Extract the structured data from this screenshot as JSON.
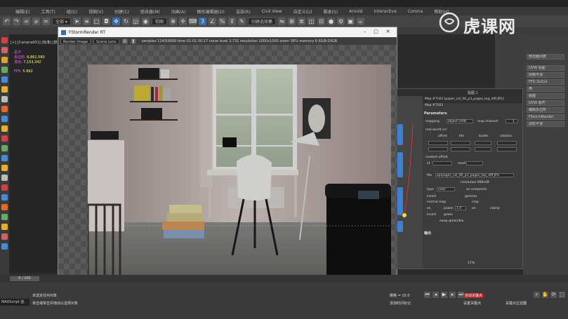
{
  "menu": [
    "编辑(E)",
    "工具(T)",
    "组(G)",
    "视图(V)",
    "创建(C)",
    "修改器(M)",
    "动画(A)",
    "图形编辑器(D)",
    "渲染(R)",
    "Civil View",
    "自定义(U)",
    "脚本(S)",
    "Arnold",
    "Interactive",
    "Corona",
    "帮助(H)"
  ],
  "toolbar": {
    "view_select": "视图",
    "selection_set": "创建选择集"
  },
  "viewport": {
    "label": "[+] [Camera001] [标准] [默认明暗处理]",
    "stats": {
      "header": "总计",
      "polys_label": "多边形:",
      "polys_value": "6,861,580",
      "verts_label": "顶点:",
      "verts_value": "7,153,342",
      "fps_label": "FPS:",
      "fps_value": "5.992"
    }
  },
  "framebuffer": {
    "title": "FStormRender RT",
    "layer_select": "Render Image",
    "lens_select": "Scene-Lens",
    "info": "samples 114/50000   time 01:01:30:17   noise level 3.731   resolution 1000x1000   zoom 38%   memory 6.60/8.00GB"
  },
  "material_editor": {
    "window_title": "贴图 1",
    "map_title": "Map #7163 [paper_col_06_p3_pages_top_diff.JPG]",
    "map_type": "Map #7163",
    "section_params": "Parameters",
    "mapping_label": "mapping",
    "mapping_value": "object UVW",
    "map_channel_label": "map channel",
    "map_channel_value": "1",
    "real_world_label": "real-world scl",
    "offset_label": "offset",
    "tiling_label": "tile",
    "mirror_label": "borde",
    "rotation_label": "rotation",
    "random_offset_label": "random offset",
    "id_label": "id",
    "seed_label": "seed",
    "file_label": "file",
    "file_value": "ap\\pages_col_06_p3_pages_top_diff.JPG",
    "resolution_label": "resolution 900x48",
    "type_label": "type",
    "type_value": "color",
    "as_compressed_label": "as compressi",
    "invert_label": "invert",
    "gamma_label": "gamma",
    "normal_map_label": "normal map",
    "crop_label": "crop",
    "on_label": "on",
    "power_label": "power",
    "power_value": "1.0",
    "clamp_label": "clamp",
    "green_label": "green",
    "swap_label": "swap green/blu",
    "section_output": "输出",
    "zoom_value": "17%"
  },
  "right_panel": {
    "buttons": [
      "修改器列表",
      "UVW 贴图",
      "网格平滑",
      "FFD 2x2x2",
      "壳",
      "曲面",
      "UVW 展开",
      "编辑多边形",
      "FStormRender",
      "涡轮平滑"
    ]
  },
  "timeline": {
    "frame": "0 / 100"
  },
  "status": {
    "maxscript": "MAXScript 迷.",
    "line1": "未选定任何对象",
    "line2": "单击或单击并拖动以选择对象",
    "grid": "栅格 = 10.0",
    "add_time_tag": "添加时间标记",
    "auto_key": "自动关键点",
    "set_key": "设置关键点",
    "key_filter": "关键点过滤器"
  },
  "watermark": "虎课网",
  "colors": {
    "accent_blue": "#3a6da8",
    "stats_magenta": "#ff66ff",
    "stats_yellow": "#ffff55",
    "node_blue": "#3f7fd0"
  }
}
